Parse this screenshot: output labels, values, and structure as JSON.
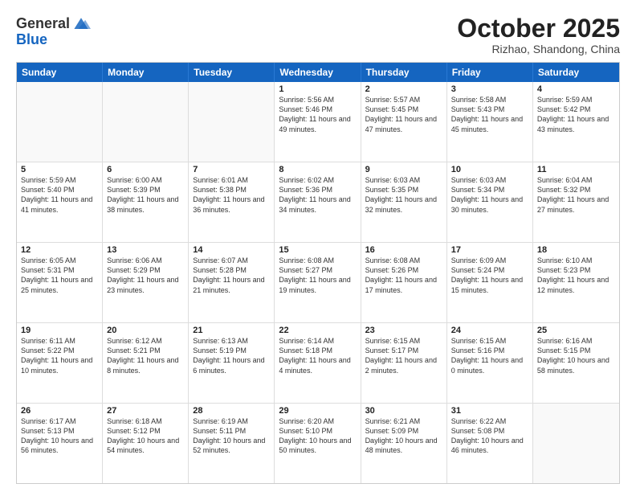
{
  "header": {
    "logo_general": "General",
    "logo_blue": "Blue",
    "month": "October 2025",
    "location": "Rizhao, Shandong, China"
  },
  "days_of_week": [
    "Sunday",
    "Monday",
    "Tuesday",
    "Wednesday",
    "Thursday",
    "Friday",
    "Saturday"
  ],
  "weeks": [
    [
      {
        "day": "",
        "empty": true
      },
      {
        "day": "",
        "empty": true
      },
      {
        "day": "",
        "empty": true
      },
      {
        "day": "1",
        "sunrise": "Sunrise: 5:56 AM",
        "sunset": "Sunset: 5:46 PM",
        "daylight": "Daylight: 11 hours and 49 minutes."
      },
      {
        "day": "2",
        "sunrise": "Sunrise: 5:57 AM",
        "sunset": "Sunset: 5:45 PM",
        "daylight": "Daylight: 11 hours and 47 minutes."
      },
      {
        "day": "3",
        "sunrise": "Sunrise: 5:58 AM",
        "sunset": "Sunset: 5:43 PM",
        "daylight": "Daylight: 11 hours and 45 minutes."
      },
      {
        "day": "4",
        "sunrise": "Sunrise: 5:59 AM",
        "sunset": "Sunset: 5:42 PM",
        "daylight": "Daylight: 11 hours and 43 minutes."
      }
    ],
    [
      {
        "day": "5",
        "sunrise": "Sunrise: 5:59 AM",
        "sunset": "Sunset: 5:40 PM",
        "daylight": "Daylight: 11 hours and 41 minutes."
      },
      {
        "day": "6",
        "sunrise": "Sunrise: 6:00 AM",
        "sunset": "Sunset: 5:39 PM",
        "daylight": "Daylight: 11 hours and 38 minutes."
      },
      {
        "day": "7",
        "sunrise": "Sunrise: 6:01 AM",
        "sunset": "Sunset: 5:38 PM",
        "daylight": "Daylight: 11 hours and 36 minutes."
      },
      {
        "day": "8",
        "sunrise": "Sunrise: 6:02 AM",
        "sunset": "Sunset: 5:36 PM",
        "daylight": "Daylight: 11 hours and 34 minutes."
      },
      {
        "day": "9",
        "sunrise": "Sunrise: 6:03 AM",
        "sunset": "Sunset: 5:35 PM",
        "daylight": "Daylight: 11 hours and 32 minutes."
      },
      {
        "day": "10",
        "sunrise": "Sunrise: 6:03 AM",
        "sunset": "Sunset: 5:34 PM",
        "daylight": "Daylight: 11 hours and 30 minutes."
      },
      {
        "day": "11",
        "sunrise": "Sunrise: 6:04 AM",
        "sunset": "Sunset: 5:32 PM",
        "daylight": "Daylight: 11 hours and 27 minutes."
      }
    ],
    [
      {
        "day": "12",
        "sunrise": "Sunrise: 6:05 AM",
        "sunset": "Sunset: 5:31 PM",
        "daylight": "Daylight: 11 hours and 25 minutes."
      },
      {
        "day": "13",
        "sunrise": "Sunrise: 6:06 AM",
        "sunset": "Sunset: 5:29 PM",
        "daylight": "Daylight: 11 hours and 23 minutes."
      },
      {
        "day": "14",
        "sunrise": "Sunrise: 6:07 AM",
        "sunset": "Sunset: 5:28 PM",
        "daylight": "Daylight: 11 hours and 21 minutes."
      },
      {
        "day": "15",
        "sunrise": "Sunrise: 6:08 AM",
        "sunset": "Sunset: 5:27 PM",
        "daylight": "Daylight: 11 hours and 19 minutes."
      },
      {
        "day": "16",
        "sunrise": "Sunrise: 6:08 AM",
        "sunset": "Sunset: 5:26 PM",
        "daylight": "Daylight: 11 hours and 17 minutes."
      },
      {
        "day": "17",
        "sunrise": "Sunrise: 6:09 AM",
        "sunset": "Sunset: 5:24 PM",
        "daylight": "Daylight: 11 hours and 15 minutes."
      },
      {
        "day": "18",
        "sunrise": "Sunrise: 6:10 AM",
        "sunset": "Sunset: 5:23 PM",
        "daylight": "Daylight: 11 hours and 12 minutes."
      }
    ],
    [
      {
        "day": "19",
        "sunrise": "Sunrise: 6:11 AM",
        "sunset": "Sunset: 5:22 PM",
        "daylight": "Daylight: 11 hours and 10 minutes."
      },
      {
        "day": "20",
        "sunrise": "Sunrise: 6:12 AM",
        "sunset": "Sunset: 5:21 PM",
        "daylight": "Daylight: 11 hours and 8 minutes."
      },
      {
        "day": "21",
        "sunrise": "Sunrise: 6:13 AM",
        "sunset": "Sunset: 5:19 PM",
        "daylight": "Daylight: 11 hours and 6 minutes."
      },
      {
        "day": "22",
        "sunrise": "Sunrise: 6:14 AM",
        "sunset": "Sunset: 5:18 PM",
        "daylight": "Daylight: 11 hours and 4 minutes."
      },
      {
        "day": "23",
        "sunrise": "Sunrise: 6:15 AM",
        "sunset": "Sunset: 5:17 PM",
        "daylight": "Daylight: 11 hours and 2 minutes."
      },
      {
        "day": "24",
        "sunrise": "Sunrise: 6:15 AM",
        "sunset": "Sunset: 5:16 PM",
        "daylight": "Daylight: 11 hours and 0 minutes."
      },
      {
        "day": "25",
        "sunrise": "Sunrise: 6:16 AM",
        "sunset": "Sunset: 5:15 PM",
        "daylight": "Daylight: 10 hours and 58 minutes."
      }
    ],
    [
      {
        "day": "26",
        "sunrise": "Sunrise: 6:17 AM",
        "sunset": "Sunset: 5:13 PM",
        "daylight": "Daylight: 10 hours and 56 minutes."
      },
      {
        "day": "27",
        "sunrise": "Sunrise: 6:18 AM",
        "sunset": "Sunset: 5:12 PM",
        "daylight": "Daylight: 10 hours and 54 minutes."
      },
      {
        "day": "28",
        "sunrise": "Sunrise: 6:19 AM",
        "sunset": "Sunset: 5:11 PM",
        "daylight": "Daylight: 10 hours and 52 minutes."
      },
      {
        "day": "29",
        "sunrise": "Sunrise: 6:20 AM",
        "sunset": "Sunset: 5:10 PM",
        "daylight": "Daylight: 10 hours and 50 minutes."
      },
      {
        "day": "30",
        "sunrise": "Sunrise: 6:21 AM",
        "sunset": "Sunset: 5:09 PM",
        "daylight": "Daylight: 10 hours and 48 minutes."
      },
      {
        "day": "31",
        "sunrise": "Sunrise: 6:22 AM",
        "sunset": "Sunset: 5:08 PM",
        "daylight": "Daylight: 10 hours and 46 minutes."
      },
      {
        "day": "",
        "empty": true
      }
    ]
  ]
}
